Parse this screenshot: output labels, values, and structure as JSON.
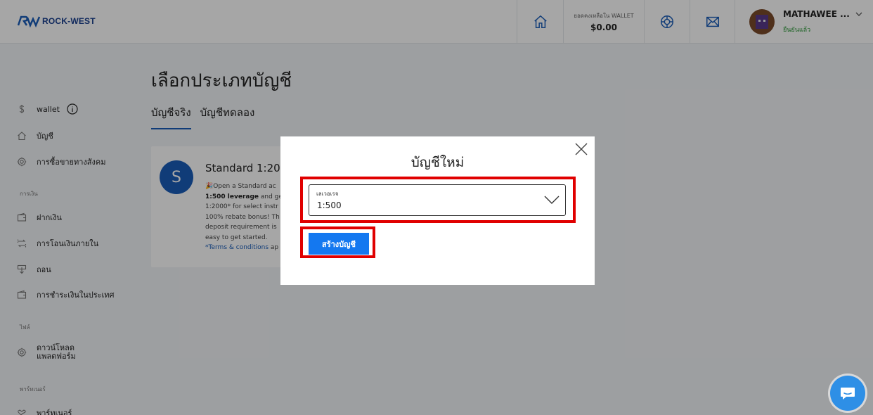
{
  "brand": {
    "name": "ROCK-WEST"
  },
  "header": {
    "wallet_caption": "ยอดคงเหลือใน WALLET",
    "wallet_value": "$0.00",
    "user_name": "MATHAWEE ...",
    "user_status": "ยืนยันแล้ว",
    "icons": [
      "home-icon",
      "support-icon",
      "mail-icon",
      "chevron-down-icon"
    ]
  },
  "sidebar": {
    "wallet_label": "wallet",
    "accounts_label": "บัญชี",
    "social_trading_label": "การซื้อขายทางสังคม",
    "section_finance": "การเงิน",
    "deposit_label": "ฝากเงิน",
    "internal_transfer_label": "การโอนเงินภายใน",
    "withdraw_label": "ถอน",
    "local_payment_label": "การชำระเงินในประเทศ",
    "section_files": "ไฟล์",
    "download_platform_line1": "ดาวน์โหลด",
    "download_platform_line2": "แพลตฟอร์ม",
    "section_partner": "พาร์ทเนอร์",
    "partner_label": "พาร์ทเนอร์"
  },
  "main": {
    "title": "เลือกประเภทบัญชี",
    "tabs": [
      {
        "label": "บัญชีจริง",
        "active": true
      },
      {
        "label": "บัญชีทดลอง",
        "active": false
      }
    ],
    "card": {
      "avatar_letter": "S",
      "title": "Standard 1:200",
      "desc_line1": "🎉Open a Standard ac",
      "desc_line2_bold": "1:500 leverage",
      "desc_line2_rest": " and ge",
      "desc_line3": "1:2000* for select instr",
      "desc_line4": "100% rebate bonus! Th",
      "desc_line5": "deposit requirement is",
      "desc_line6": "easy to get started.",
      "terms": "*Terms & conditions",
      "terms_rest": " ap"
    }
  },
  "modal": {
    "title": "บัญชีใหม่",
    "leverage_label": "เลเวอเรจ",
    "leverage_value": "1:500",
    "create_button": "สร้างบัญชี"
  },
  "colors": {
    "accent": "#1a5cb8",
    "button": "#1478f0",
    "highlight": "#e00000",
    "status_green": "#2e9a3a"
  }
}
